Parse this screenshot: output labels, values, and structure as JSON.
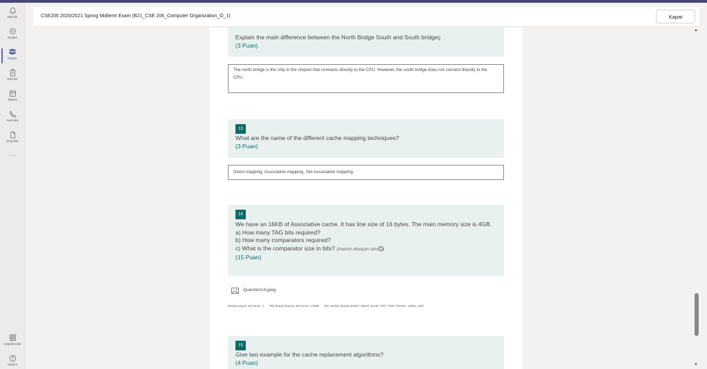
{
  "rail": {
    "items": [
      {
        "label": "Etkinlik",
        "icon": "bell-icon"
      },
      {
        "label": "Sohbet",
        "icon": "chat-icon"
      },
      {
        "label": "Ekipler",
        "icon": "teams-icon"
      },
      {
        "label": "Ödevler",
        "icon": "assignments-icon"
      },
      {
        "label": "Takvim",
        "icon": "calendar-icon"
      },
      {
        "label": "Aramalar",
        "icon": "phone-icon"
      },
      {
        "label": "Dosyalar",
        "icon": "file-icon"
      }
    ],
    "more": "···",
    "bottom_items": [
      {
        "label": "Uygulamalar",
        "icon": "apps-icon"
      },
      {
        "label": "Yardım",
        "icon": "help-icon"
      }
    ]
  },
  "header": {
    "title": "CSE206 2020/2021 Spring Midterm Exam (B21_CSE 206_Computer Organization_Ö_1)",
    "close_label": "Kapat"
  },
  "questions": [
    {
      "number": "",
      "text": "Explain the main difference between the North Bridge South and South bridgeç",
      "points": "(3 Puan)",
      "answer": "The north bridge is the chip in the chipset that connects directly to the CPU. However, the south bridge does not connect directly to the CPU."
    },
    {
      "number": "13",
      "text": "What are the name of the different cache mapping techniques?",
      "points": "(3 Puan)",
      "answer": "Direct mapping, Associative mapping, Set-Associative mapping."
    },
    {
      "number": "14",
      "text_lines": [
        "We have an 16KB of Associative cache. It has line size of 16 bytes. The main memory size is 4GB.",
        "a) How many TAG bits required?",
        "b) How many comparators required?",
        "c) What is the comparator size in bits?"
      ],
      "anon_note": "(Anonim olmayan soru",
      "anon_icon": "i",
      "anon_close": ")",
      "points": "(15 Puan)",
      "file_name": "Question14.jpeg",
      "limits": [
        "Dosya sayısı üst sınırı: 1",
        "Tek dosya boyutu üst sınırı: 10MB",
        "İzin verilen dosya türleri: Word, Excel, PPT, PDF, Resim, Video, Ses"
      ]
    },
    {
      "number": "15",
      "text": "Give two example for the cache replacement algorithms?",
      "points": "(4 Puan)"
    }
  ],
  "colors": {
    "accent": "#6264a7",
    "question_badge": "#0b6a66",
    "question_bg": "#e9f1f0"
  }
}
